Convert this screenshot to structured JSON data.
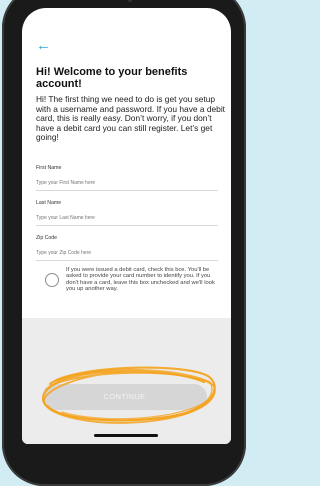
{
  "screen": {
    "back_label": "←",
    "title": "Hi! Welcome to your benefits account!",
    "intro": "Hi! The first thing we need to do is get you setup with a username and password. If you have a debit card, this is really easy. Don’t worry, if you don’t have a debit card you can still register. Let’s get going!"
  },
  "form": {
    "first_name": {
      "label": "First Name",
      "placeholder": "Type your First Name here"
    },
    "last_name": {
      "label": "Last Name",
      "placeholder": "Type your Last Name here"
    },
    "zip_code": {
      "label": "Zip Code",
      "placeholder": "Type your Zip Code here"
    },
    "debit_card_text": "If you were issued a debit card, check this box. You'll be asked to provide your card number to identify you. If you don't have a card, leave this box unchecked and we'll look you up another way.",
    "continue_label": "CONTINUE"
  },
  "colors": {
    "accent": "#29a9d6",
    "highlight": "#f5a21b",
    "button_bg": "#d6d6d6"
  }
}
